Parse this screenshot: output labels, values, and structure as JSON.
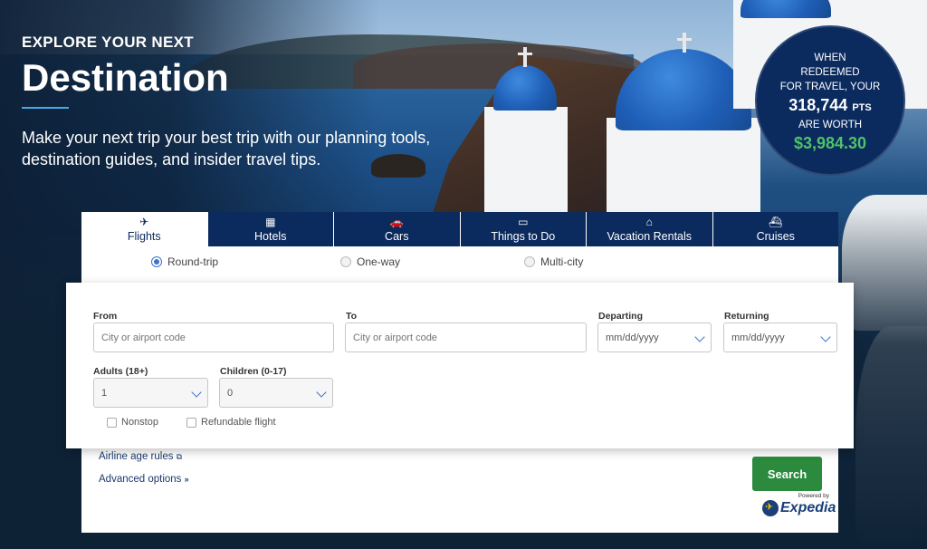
{
  "hero": {
    "eyebrow": "EXPLORE YOUR NEXT",
    "headline": "Destination",
    "subtitle": "Make your next trip your best trip with our planning tools, destination guides, and insider travel tips."
  },
  "points_badge": {
    "line1": "WHEN",
    "line2": "REDEEMED",
    "line3": "FOR TRAVEL, YOUR",
    "points": "318,744",
    "points_unit": "PTS",
    "line4": "ARE WORTH",
    "value": "$3,984.30"
  },
  "tabs": [
    {
      "label": "Flights",
      "icon": "plane-icon",
      "glyph": "✈",
      "active": true
    },
    {
      "label": "Hotels",
      "icon": "hotel-icon",
      "glyph": "▦",
      "active": false
    },
    {
      "label": "Cars",
      "icon": "car-icon",
      "glyph": "🚗",
      "active": false
    },
    {
      "label": "Things to Do",
      "icon": "ticket-icon",
      "glyph": "▭",
      "active": false
    },
    {
      "label": "Vacation Rentals",
      "icon": "house-icon",
      "glyph": "⌂",
      "active": false
    },
    {
      "label": "Cruises",
      "icon": "ship-icon",
      "glyph": "⛴",
      "active": false
    }
  ],
  "trip_types": [
    {
      "label": "Round-trip",
      "selected": true
    },
    {
      "label": "One-way",
      "selected": false
    },
    {
      "label": "Multi-city",
      "selected": false
    }
  ],
  "form": {
    "from_label": "From",
    "from_placeholder": "City or airport code",
    "to_label": "To",
    "to_placeholder": "City or airport code",
    "departing_label": "Departing",
    "departing_value": "mm/dd/yyyy",
    "returning_label": "Returning",
    "returning_value": "mm/dd/yyyy",
    "adults_label": "Adults (18+)",
    "adults_value": "1",
    "children_label": "Children (0-17)",
    "children_value": "0",
    "nonstop_label": "Nonstop",
    "refundable_label": "Refundable flight"
  },
  "links": {
    "airline_age_rules": "Airline age rules",
    "advanced_options": "Advanced options"
  },
  "search_label": "Search",
  "powered": {
    "by": "Powered by",
    "brand": "Expedia"
  },
  "colors": {
    "navy": "#0b2a5e",
    "green": "#2b8a3e",
    "points_value": "#4fc26a",
    "accent_blue": "#3a74c9"
  }
}
